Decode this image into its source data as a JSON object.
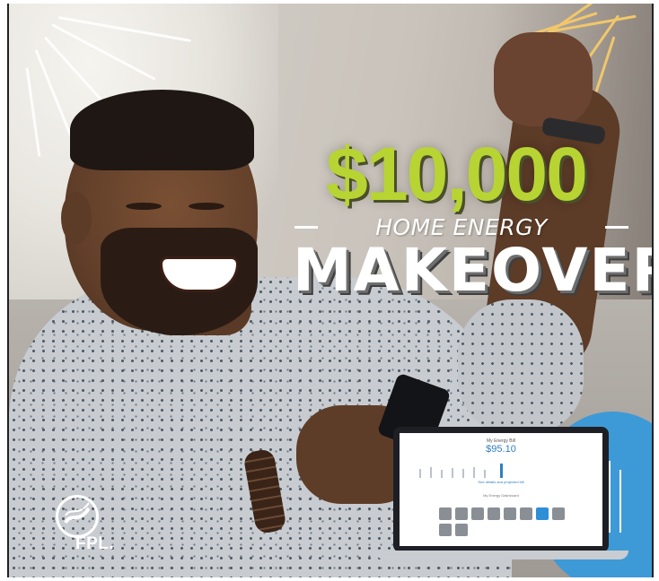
{
  "ad": {
    "headline_amount": "$10,000",
    "headline_sub": "HOME ENERGY",
    "headline_main": "MAKEOVER",
    "brand_logo": "FPL."
  },
  "laptop": {
    "screen_title": "My Energy Bill",
    "bill_amount": "$95.10",
    "link_text": "See details and projected bill",
    "section_label": "My Energy Dashboard"
  },
  "colors": {
    "headline_green": "#b7d433",
    "accent_blue": "#3e9ad6",
    "ray_gold": "#f2c76a"
  },
  "icons": [
    "fpl-logo-icon",
    "wave-icon",
    "sun-rays-icon",
    "smartphone-icon",
    "laptop-icon"
  ]
}
